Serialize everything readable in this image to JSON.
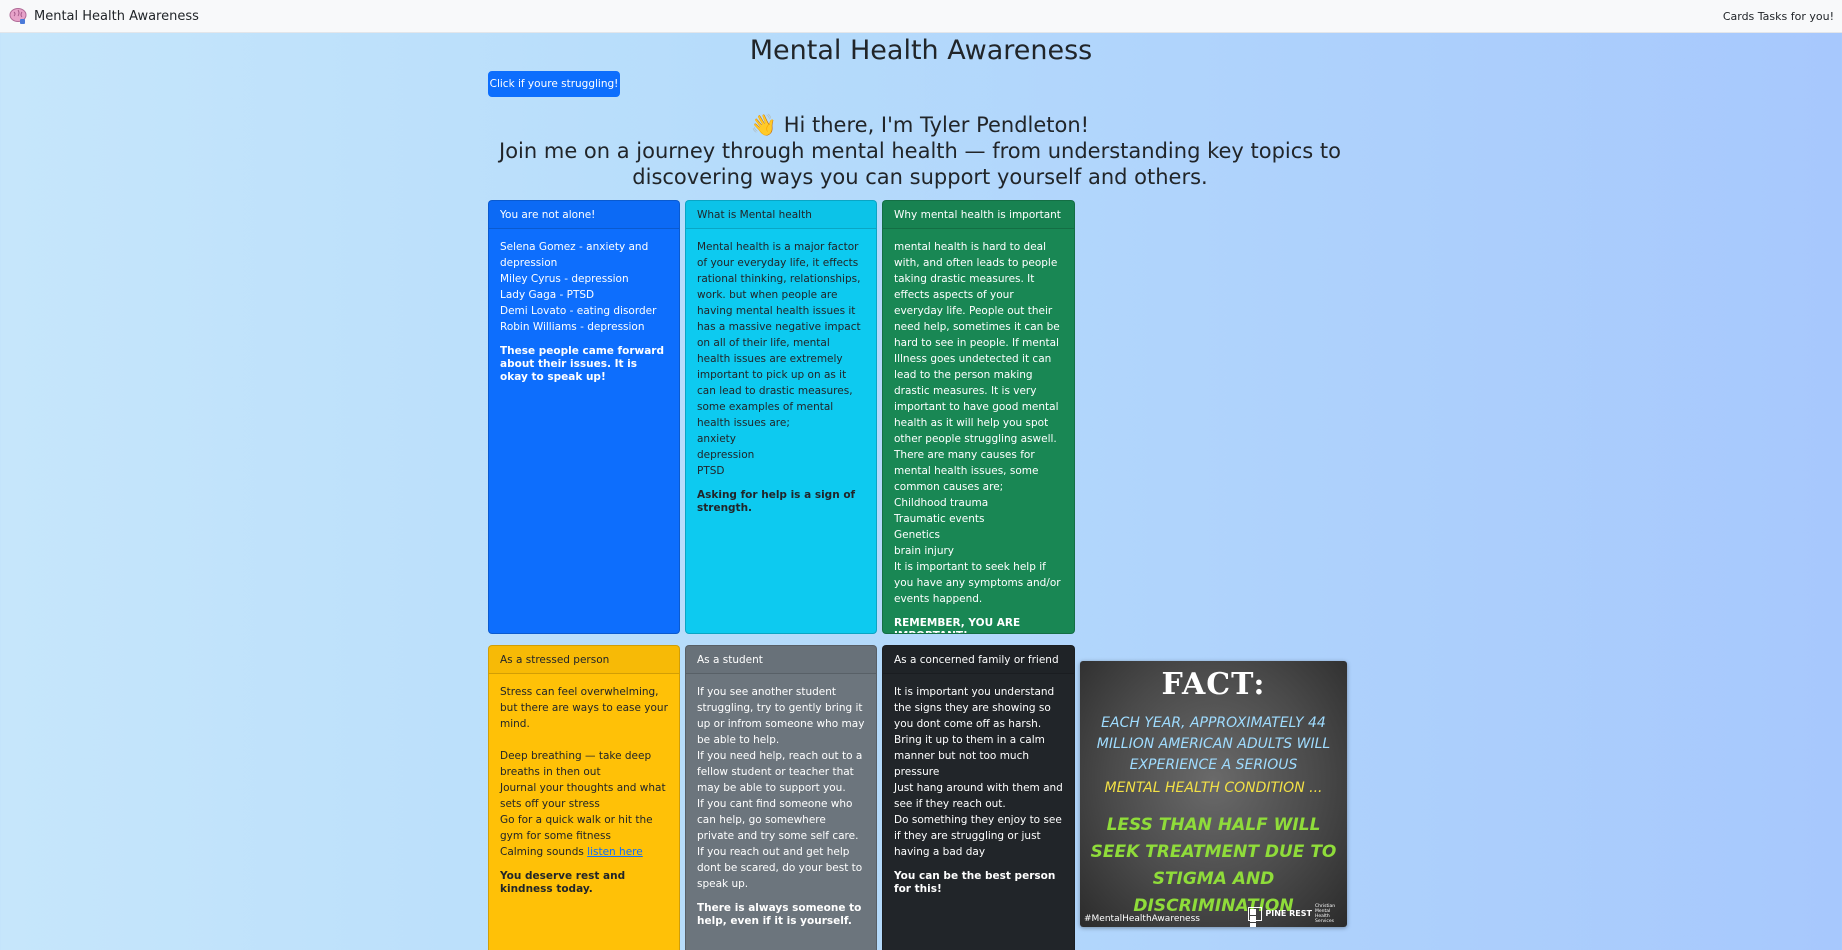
{
  "navbar": {
    "brand_label": "Mental Health Awareness",
    "brand_icon": "brain-icon",
    "right_link": "Cards Tasks for you!"
  },
  "page_title": "Mental Health Awareness",
  "help_button": "Click if youre struggling!",
  "intro": {
    "greeting": "👋 Hi there, I'm Tyler Pendleton!",
    "subtitle": "Join me on a journey through mental health — from understanding key topics to discovering ways you can support yourself and others."
  },
  "cards": {
    "alone": {
      "header": "You are not alone!",
      "lines": [
        "Selena Gomez - anxiety and depression",
        "Miley Cyrus - depression",
        "Lady Gaga - PTSD",
        "Demi Lovato - eating disorder",
        "Robin Williams - depression"
      ],
      "closing": "These people came forward about their issues. It is okay to speak up!"
    },
    "what": {
      "header": "What is Mental health",
      "text": "Mental health is a major factor of your everyday life, it effects rational thinking, relationships, work. but when people are having mental health issues it has a massive negative impact on all of their life, mental health issues are extremely important to pick up on as it can lead to drastic measures, some examples of mental health issues are;",
      "list": [
        "anxiety",
        "depression",
        "PTSD"
      ],
      "closing": "Asking for help is a sign of strength."
    },
    "why": {
      "header": "Why mental health is important",
      "text": "mental health is hard to deal with, and often leads to people taking drastic measures. It effects aspects of your everyday life. People out their need help, sometimes it can be hard to see in people. If mental Illness goes undetected it can lead to the person making drastic measures. It is very important to have good mental health as it will help you spot other people struggling aswell. There are many causes for mental health issues, some common causes are;",
      "list": [
        "Childhood trauma",
        "Traumatic events",
        "Genetics",
        "brain injury",
        "It is important to seek help if you have any symptoms and/or events happend."
      ],
      "closing": "REMEMBER, YOU ARE IMPORTANT!"
    },
    "stressed": {
      "header": "As a stressed person",
      "intro": "Stress can feel overwhelming, but there are ways to ease your mind.",
      "lines": [
        "Deep breathing — take deep breaths in then out",
        "Journal your thoughts and what sets off your stress",
        "Go for a quick walk or hit the gym for some fitness"
      ],
      "calm_prefix": "Calming sounds ",
      "calm_link": "listen here",
      "closing": "You deserve rest and kindness today."
    },
    "student": {
      "header": "As a student",
      "lines": [
        "If you see another student struggling, try to gently bring it up or infrom someone who may be able to help.",
        "If you need help, reach out to a fellow student or teacher that may be able to support you.",
        "If you cant find someone who can help, go somewhere private and try some self care.",
        "If you reach out and get help dont be scared, do your best to speak up."
      ],
      "closing": "There is always someone to help, even if it is yourself."
    },
    "family": {
      "header": "As a concerned family or friend",
      "lines": [
        "It is important you understand the signs they are showing so you dont come off as harsh.",
        "Bring it up to them in a calm manner but not too much pressure",
        "Just hang around with them and see if they reach out.",
        "Do something they enjoy to see if they are struggling or just having a bad day"
      ],
      "closing": "You can be the best person for this!"
    }
  },
  "poster": {
    "fact": "FACT:",
    "line1": "EACH YEAR, APPROXIMATELY 44 MILLION AMERICAN ADULTS WILL EXPERIENCE A SERIOUS",
    "line2": "MENTAL HEALTH CONDITION ...",
    "line3": "LESS THAN HALF WILL SEEK TREATMENT DUE TO STIGMA AND DISCRIMINATION",
    "hashtag": "#MentalHealthAwareness",
    "logo_text": "PINE REST",
    "logo_sub": "Christian Mental Health Services"
  }
}
